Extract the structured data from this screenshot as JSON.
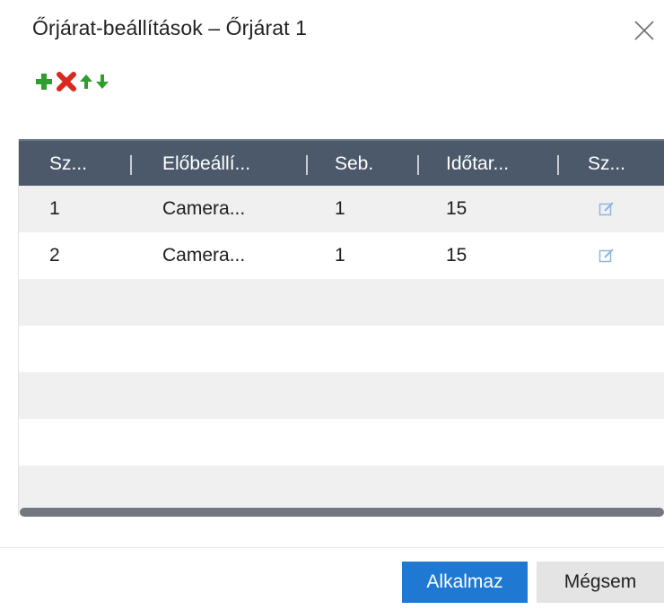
{
  "dialog": {
    "title": "Őrjárat-beállítások – Őrjárat 1",
    "close_icon": "close-icon"
  },
  "toolbar": {
    "icons": [
      "add-icon",
      "delete-icon",
      "move-up-icon",
      "move-down-icon"
    ],
    "colors": {
      "add": "#2e9e2e",
      "delete": "#d82a1f",
      "arrows": "#2e9e2e"
    }
  },
  "table": {
    "columns": [
      "Sz...",
      "Előbeállí...",
      "Seb.",
      "Időtar...",
      "Sz..."
    ],
    "rows": [
      {
        "no": "1",
        "preset": "Camera...",
        "speed": "1",
        "duration": "15",
        "action_icon": "edit-icon"
      },
      {
        "no": "2",
        "preset": "Camera...",
        "speed": "1",
        "duration": "15",
        "action_icon": "edit-icon"
      }
    ],
    "colors": {
      "header_bg": "#4c596b",
      "row_shade": "#f0f0f0",
      "edit_icon": "#8fb6e0"
    }
  },
  "footer": {
    "apply_label": "Alkalmaz",
    "cancel_label": "Mégsem",
    "colors": {
      "apply_bg": "#1f78d1",
      "cancel_bg": "#e4e4e4"
    }
  }
}
